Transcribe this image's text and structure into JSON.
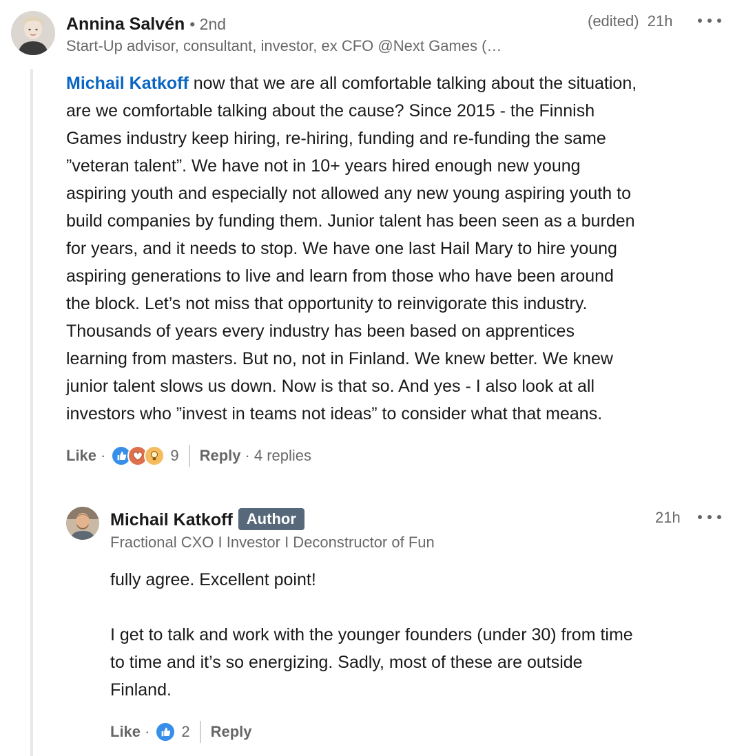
{
  "comment": {
    "author_name": "Annina Salvén",
    "degree": "• 2nd",
    "headline": "Start-Up advisor, consultant, investor, ex CFO @Next Games (…",
    "edited": "(edited)",
    "time": "21h",
    "mention": "Michail Katkoff",
    "text_lines": [
      " now that we are all comfortable talking about the situation,",
      "are we comfortable talking about the cause? Since 2015 - the Finnish",
      "Games industry keep hiring, re-hiring, funding and re-funding the same",
      "”veteran talent”. We have not in 10+ years hired enough new young",
      "aspiring youth and especially not allowed any new young aspiring youth to",
      "build companies by funding them. Junior talent has been seen as a burden",
      "for years, and it needs to stop. We have one last Hail Mary to hire young",
      "aspiring generations to live and learn from those who have been around",
      "the block. Let’s not miss that opportunity to reinvigorate this industry.",
      "Thousands of years every industry has been based on apprentices",
      "learning from masters. But no, not in Finland. We knew better. We knew",
      "junior talent slows us down. Now is that so. And yes - I also look at all",
      "investors who ”invest in teams not ideas” to consider what that means."
    ],
    "like_label": "Like",
    "reaction_count": "9",
    "reply_label": "Reply",
    "replies_count": "4 replies",
    "reactions": [
      "like-icon",
      "love-icon",
      "insightful-icon"
    ]
  },
  "reply": {
    "author_name": "Michail Katkoff",
    "badge": "Author",
    "headline": "Fractional CXO I Investor I Deconstructor of Fun",
    "time": "21h",
    "text_line1": "fully agree. Excellent point!",
    "text_line2": "I get to talk and work with the younger founders (under 30) from time",
    "text_line3": "to time and it’s so energizing. Sadly, most of these are outside",
    "text_line4": "Finland.",
    "like_label": "Like",
    "reaction_count": "2",
    "reply_label": "Reply",
    "reactions": [
      "like-icon"
    ]
  },
  "colors": {
    "mention": "#0a66c2",
    "author_badge_bg": "#56687a",
    "like_reaction": "#378fe9",
    "love_reaction": "#df704d",
    "insightful_reaction": "#f5bb5c",
    "thread_line": "#e8e8e8"
  }
}
